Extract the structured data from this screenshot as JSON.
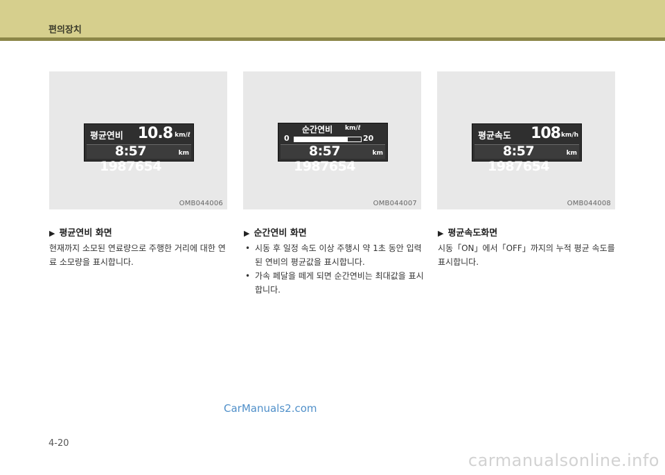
{
  "header": {
    "title": "편의장치"
  },
  "panels": [
    {
      "code": "OMB044006",
      "display": {
        "label": "평균연비",
        "value": "10.8",
        "unit": "km/ℓ",
        "trip": "8:57 1987654",
        "trip_unit": "km"
      },
      "heading": "평균연비 화면",
      "text": "현재까지 소모된 연료량으로 주행한 거리에 대한 연료 소모량을 표시합니다."
    },
    {
      "code": "OMB044007",
      "display": {
        "label": "순간연비",
        "unit": "km/ℓ",
        "bar_min": "0",
        "bar_max": "20",
        "bar_level": 0.8,
        "trip": "8:57 1987654",
        "trip_unit": "km"
      },
      "heading": "순간연비 화면",
      "bullets": [
        "시동 후 일정 속도 이상 주행시 약 1초 동안 입력된 연비의 평균값을 표시합니다.",
        "가속 페달을 떼게 되면 순간연비는 최대값을 표시합니다."
      ]
    },
    {
      "code": "OMB044008",
      "display": {
        "label": "평균속도",
        "value": "108",
        "unit": "km/h",
        "trip": "8:57 1987654",
        "trip_unit": "km"
      },
      "heading": "평균속도화면",
      "text": "시동「ON」에서「OFF」까지의 누적 평균 속도를 표시합니다."
    }
  ],
  "watermark": "CarManuals2.com",
  "page_number": "4-20",
  "footer_watermark": "carmanualsonline.info",
  "colors": {
    "header_bg": "#d6cf8d",
    "header_line": "#8c8748",
    "panel_bg": "#e8e8e8",
    "lcd_bg": "#2f2f2f",
    "watermark": "#4f8fc9"
  }
}
